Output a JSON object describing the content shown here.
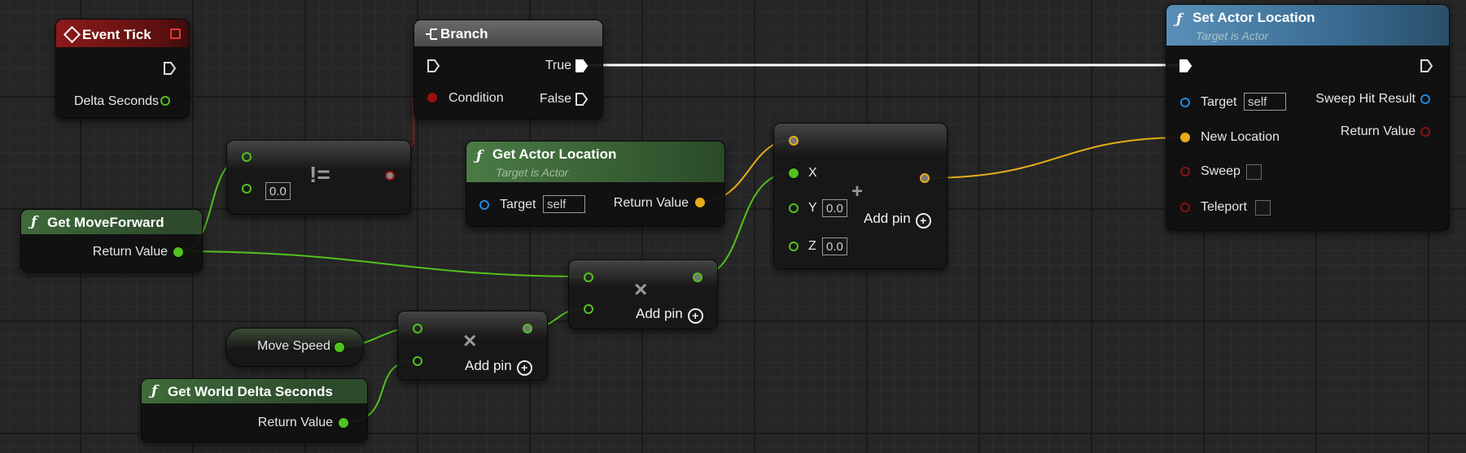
{
  "event_tick": {
    "title": "Event Tick",
    "pins": {
      "delta_seconds": "Delta Seconds"
    }
  },
  "branch": {
    "title": "Branch",
    "pins": {
      "condition": "Condition",
      "true": "True",
      "false": "False"
    }
  },
  "not_equal": {
    "operator": "!=",
    "default_value": "0.0"
  },
  "get_move_forward": {
    "title": "Get MoveForward",
    "pins": {
      "return_value": "Return Value"
    }
  },
  "get_actor_location": {
    "title": "Get Actor Location",
    "subtitle": "Target is Actor",
    "pins": {
      "target": "Target",
      "target_value": "self",
      "return_value": "Return Value"
    }
  },
  "multiply_1": {
    "operator": "×",
    "add_pin": "Add pin"
  },
  "multiply_2": {
    "operator": "×",
    "add_pin": "Add pin"
  },
  "move_speed": {
    "label": "Move Speed"
  },
  "get_world_delta_seconds": {
    "title": "Get World Delta Seconds",
    "pins": {
      "return_value": "Return Value"
    }
  },
  "add_vector": {
    "operator": "+",
    "pins": {
      "x": "X",
      "y": "Y",
      "z": "Z",
      "y_value": "0.0",
      "z_value": "0.0"
    },
    "add_pin": "Add pin"
  },
  "set_actor_location": {
    "title": "Set Actor Location",
    "subtitle": "Target is Actor",
    "pins": {
      "target": "Target",
      "target_value": "self",
      "new_location": "New Location",
      "sweep": "Sweep",
      "teleport": "Teleport",
      "sweep_hit_result": "Sweep Hit Result",
      "return_value": "Return Value"
    }
  },
  "colors": {
    "float_pin": "#52c21c",
    "vector_pin": "#e8ad1a",
    "object_pin": "#1f8ae0",
    "bool_pin": "#9a1010",
    "exec_wire": "#ffffff",
    "event_header": "#8c1a1a",
    "pure_function_header": "#3f6b3a",
    "function_header": "#3a6c92"
  }
}
